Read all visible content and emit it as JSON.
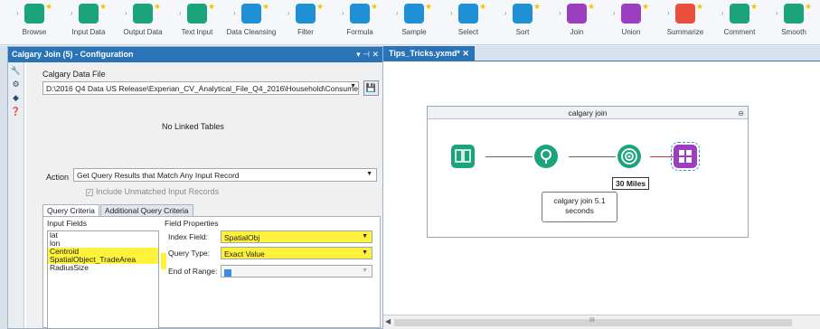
{
  "toolbar": {
    "tools": [
      {
        "label": "Browse",
        "color": "#1ba37b"
      },
      {
        "label": "Input Data",
        "color": "#1ba37b"
      },
      {
        "label": "Output Data",
        "color": "#1ba37b"
      },
      {
        "label": "Text Input",
        "color": "#1ba37b"
      },
      {
        "label": "Data Cleansing",
        "color": "#1f8fd6"
      },
      {
        "label": "Filter",
        "color": "#1f8fd6"
      },
      {
        "label": "Formula",
        "color": "#1f8fd6"
      },
      {
        "label": "Sample",
        "color": "#1f8fd6"
      },
      {
        "label": "Select",
        "color": "#1f8fd6"
      },
      {
        "label": "Sort",
        "color": "#1f8fd6"
      },
      {
        "label": "Join",
        "color": "#9b3fc0"
      },
      {
        "label": "Union",
        "color": "#9b3fc0"
      },
      {
        "label": "Summarize",
        "color": "#e84f3c"
      },
      {
        "label": "Comment",
        "color": "#1ba37b"
      },
      {
        "label": "Smooth",
        "color": "#1ba37b"
      }
    ]
  },
  "config": {
    "title": "Calgary  Join (5) - Configuration",
    "window_controls": "▾ ⊣ ✕",
    "file_label": "Calgary Data File",
    "file_path": "D:\\2016 Q4 Data US Release\\Experian_CV_Analytical_File_Q4_2016\\Household\\Consume",
    "no_linked": "No Linked Tables",
    "action_label": "Action",
    "action_value": "Get Query Results that Match Any Input Record",
    "include_unmatched": "Include Unmatched Input Records",
    "tabs": [
      "Query Criteria",
      "Additional Query Criteria"
    ],
    "input_fields_header": "Input Fields",
    "input_fields": [
      "lat",
      "lon",
      "Centroid",
      "SpatialObject_TradeArea",
      "RadiusSize"
    ],
    "field_props_header": "Field Properties",
    "index_field_label": "Index Field:",
    "index_field_value": "SpatialObj",
    "query_type_label": "Query Type:",
    "query_type_value": "Exact Value",
    "end_range_label": "End of Range:"
  },
  "workflow": {
    "tab_label": "Tips_Tricks.yxmd*  ✕",
    "container_title": "calgary join",
    "badge": "30 Miles",
    "note": "calgary join 5.1 seconds",
    "scroll_mark": "III"
  },
  "colors": {
    "highlight": "#fff23a",
    "header_blue": "#2a73b7"
  }
}
